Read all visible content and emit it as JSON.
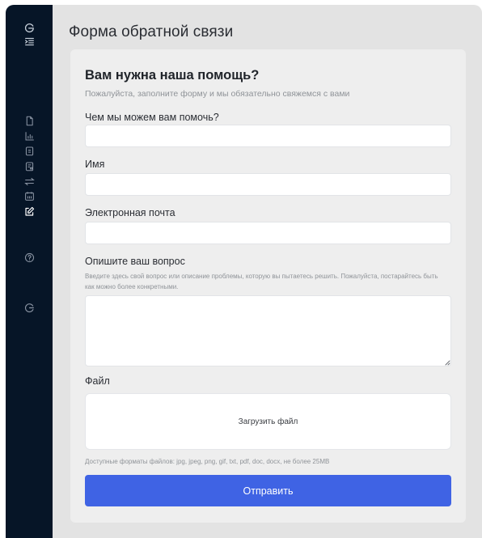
{
  "sidebar": {
    "icons": [
      "logo-icon",
      "menu-indent-icon",
      "document-icon",
      "bar-chart-icon",
      "clipboard-icon",
      "calendar-list-icon",
      "transfer-icon",
      "calendar-icon",
      "edit-icon",
      "help-icon",
      "logout-icon"
    ],
    "active_item": "edit-icon"
  },
  "page": {
    "title": "Форма обратной связи"
  },
  "form": {
    "heading": "Вам нужна наша помощь?",
    "subheading": "Пожалуйста, заполните форму и мы обязательно свяжемся с вами",
    "fields": {
      "topic": {
        "label": "Чем мы можем вам помочь?",
        "value": "",
        "placeholder": ""
      },
      "name": {
        "label": "Имя",
        "value": "",
        "placeholder": ""
      },
      "email": {
        "label": "Электронная почта",
        "value": "",
        "placeholder": ""
      },
      "question": {
        "label": "Опишите ваш вопрос",
        "hint": "Введите здесь свой вопрос или описание проблемы, которую вы пытаетесь решить. Пожалуйста, постарайтесь быть как можно более конкретными.",
        "value": ""
      }
    },
    "file": {
      "label": "Файл",
      "upload_text": "Загрузить файл",
      "formats_note": "Доступные форматы файлов: jpg, jpeg, png, gif, txt, pdf, doc, docx, не более 25MB"
    },
    "submit_label": "Отправить"
  },
  "colors": {
    "sidebar_bg": "#061527",
    "sidebar_icon": "#8a94a3",
    "sidebar_icon_active": "#ffffff",
    "page_bg": "#e3e3e3",
    "card_bg": "#eeeeee",
    "submit_bg": "#3f63e4"
  }
}
